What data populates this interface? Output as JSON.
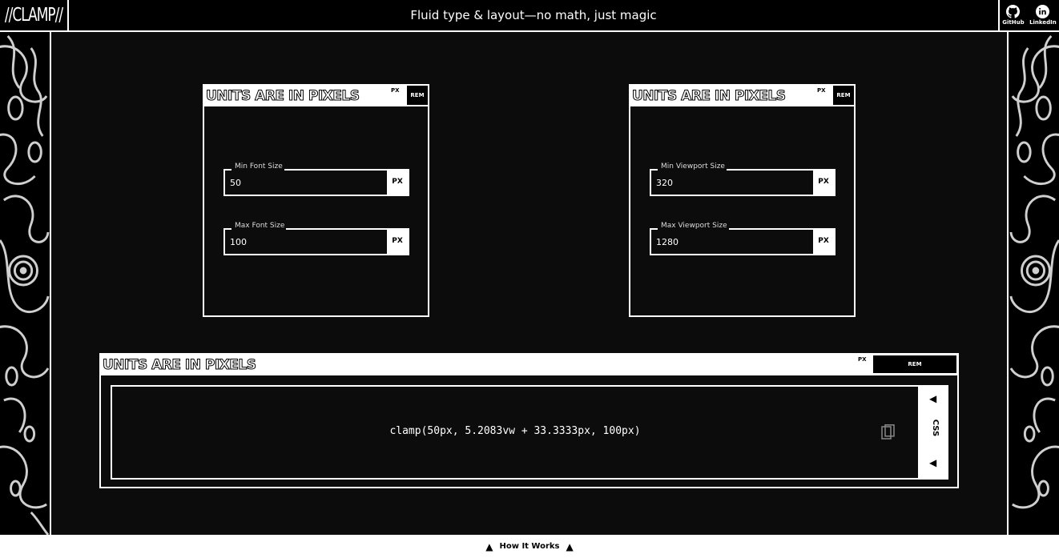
{
  "header": {
    "logo": "//CLAMP//",
    "title": "Fluid type & layout—no math, just magic",
    "social": [
      {
        "label": "GitHub",
        "icon": "github-icon"
      },
      {
        "label": "LinkedIn",
        "icon": "linkedin-icon"
      }
    ]
  },
  "font_card": {
    "title": "UNITS ARE IN PIXELS",
    "unit_px": "PX",
    "unit_rem": "REM",
    "min_label": "Min Font Size",
    "min_value": "50",
    "min_unit": "PX",
    "max_label": "Max Font Size",
    "max_value": "100",
    "max_unit": "PX"
  },
  "viewport_card": {
    "title": "UNITS ARE IN PIXELS",
    "unit_px": "PX",
    "unit_rem": "REM",
    "min_label": "Min Viewport Size",
    "min_value": "320",
    "min_unit": "PX",
    "max_label": "Max Viewport Size",
    "max_value": "1280",
    "max_unit": "PX"
  },
  "output_card": {
    "title": "UNITS ARE IN PIXELS",
    "unit_px": "PX",
    "unit_rem": "REM",
    "clamp": "clamp(50px, 5.2083vw + 33.3333px, 100px)",
    "format": "CSS",
    "copy_icon": "copy-icon"
  },
  "footer": {
    "label": "How It Works"
  },
  "colors": {
    "background": "#0c0c0c",
    "foreground": "#ffffff",
    "ink": "#000000"
  }
}
